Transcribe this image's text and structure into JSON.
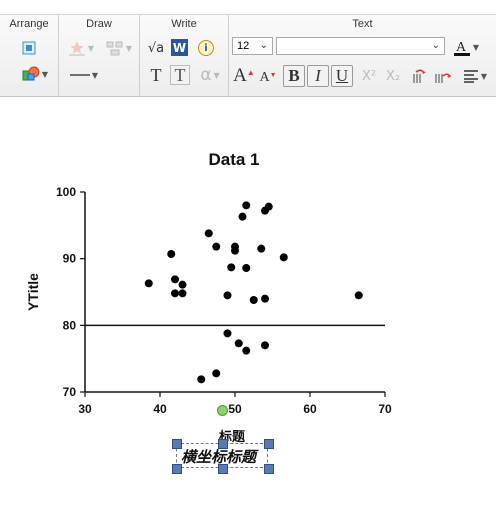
{
  "ribbon": {
    "groups": {
      "arrange": "Arrange",
      "draw": "Draw",
      "write": "Write",
      "text": "Text"
    },
    "font_size": "12",
    "font_name": "",
    "buttons": {
      "sqrt": "√a",
      "w": "W",
      "info": "i",
      "t1": "T",
      "t2": "T",
      "alpha": "α",
      "a_up": "A",
      "a_down": "A",
      "bold": "B",
      "italic": "I",
      "underline": "U",
      "superscript": "X²",
      "subscript": "X₂"
    }
  },
  "chart_data": {
    "type": "scatter",
    "title": "Data 1",
    "ylabel": "YTitle",
    "xlim": [
      30,
      70
    ],
    "ylim": [
      70,
      100
    ],
    "xticks": [
      30,
      40,
      50,
      60,
      70
    ],
    "yticks": [
      70,
      80,
      90,
      100
    ],
    "reference_line_y": 80,
    "points": [
      [
        51.5,
        98
      ],
      [
        54.5,
        97.8
      ],
      [
        54,
        97.2
      ],
      [
        51,
        96.3
      ],
      [
        46.5,
        93.8
      ],
      [
        47.5,
        91.8
      ],
      [
        50,
        91.8
      ],
      [
        50,
        91.2
      ],
      [
        53.5,
        91.5
      ],
      [
        41.5,
        90.7
      ],
      [
        56.5,
        90.2
      ],
      [
        49.5,
        88.7
      ],
      [
        51.5,
        88.6
      ],
      [
        42,
        86.9
      ],
      [
        38.5,
        86.3
      ],
      [
        43,
        86.1
      ],
      [
        42,
        84.8
      ],
      [
        43,
        84.8
      ],
      [
        49,
        84.5
      ],
      [
        54,
        84
      ],
      [
        52.5,
        83.8
      ],
      [
        66.5,
        84.5
      ],
      [
        49,
        78.8
      ],
      [
        50.5,
        77.3
      ],
      [
        54,
        77
      ],
      [
        51.5,
        76.2
      ],
      [
        47.5,
        72.8
      ],
      [
        45.5,
        71.9
      ]
    ],
    "annotations": [
      "标题",
      "横坐标标题"
    ]
  }
}
